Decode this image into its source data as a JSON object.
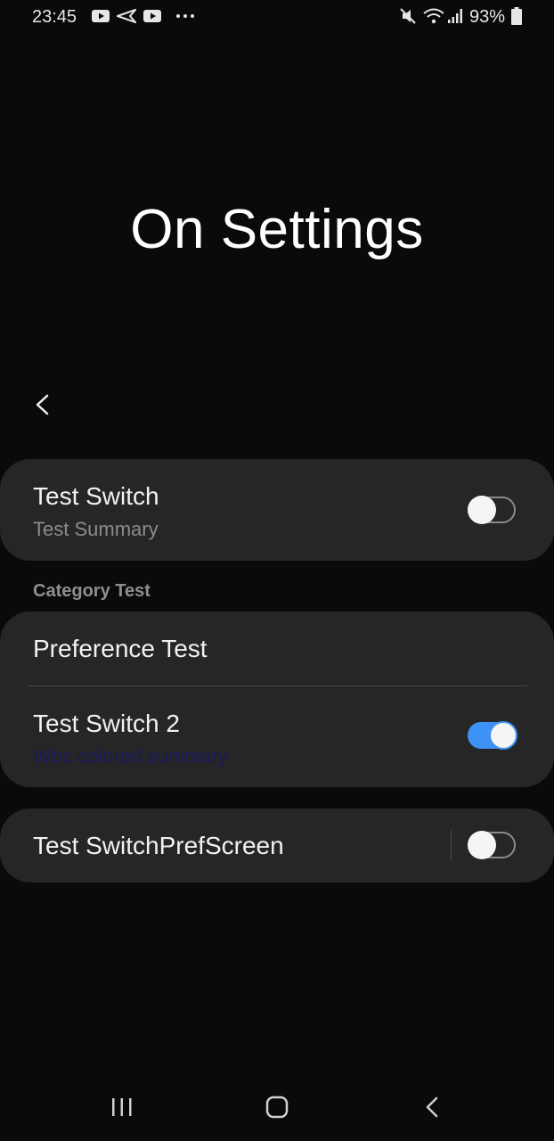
{
  "status_bar": {
    "time": "23:45",
    "battery": "93%",
    "icons_left": [
      "youtube-icon",
      "send-icon",
      "youtube-icon",
      "more-dots-icon"
    ],
    "icons_right": [
      "mute-icon",
      "wifi-icon",
      "signal-icon",
      "battery-icon"
    ]
  },
  "page": {
    "title": "On Settings"
  },
  "prefs": {
    "test_switch": {
      "title": "Test Switch",
      "summary": "Test Summary",
      "checked": false
    },
    "category": "Category Test",
    "preference_test": {
      "title": "Preference Test"
    },
    "test_switch_2": {
      "title": "Test Switch 2",
      "summary": "Wbc colored summary",
      "checked": true
    },
    "switch_pref_screen": {
      "title": "Test SwitchPrefScreen",
      "checked": false
    }
  },
  "colors": {
    "background": "#0a0a0a",
    "card": "#262626",
    "accent": "#3e91f5",
    "summary_colored": "#1c1a5e"
  },
  "nav": [
    "recents-icon",
    "home-icon",
    "back-icon"
  ]
}
